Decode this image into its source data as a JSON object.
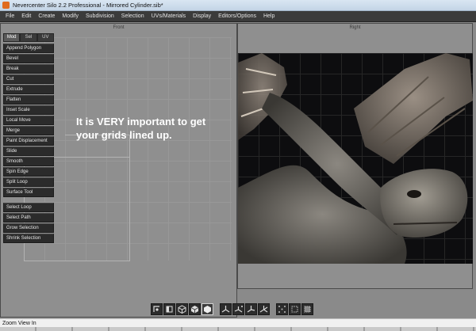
{
  "window": {
    "title": "Nevercenter Silo 2.2 Professional - Mirrored Cylinder.sib*"
  },
  "menubar": {
    "items": [
      "File",
      "Edit",
      "Create",
      "Modify",
      "Subdivision",
      "Selection",
      "UVs/Materials",
      "Display",
      "Editors/Options",
      "Help"
    ]
  },
  "viewports": {
    "left_label": "Front",
    "right_label": "Right"
  },
  "toolpanel": {
    "tabs": [
      "Mod",
      "Sel",
      "UV"
    ],
    "active_tab": "Mod",
    "tools": [
      "Append Polygon",
      "Bevel",
      "Break",
      "Cut",
      "Extrude",
      "Flatten",
      "Inset Scale",
      "Local Move",
      "Merge",
      "Paint Displacement",
      "Slide",
      "Smooth",
      "Spin Edge",
      "Split Loop",
      "Surface Tool"
    ],
    "selection_tools": [
      "Select Loop",
      "Select Path",
      "Grow Selection",
      "Shrink Selection"
    ]
  },
  "overlay": {
    "line1": "It is VERY important to get",
    "line2": "your grids lined up."
  },
  "bottom_toolbar": {
    "icons": [
      "move-tool-icon",
      "face-view-icon",
      "cube-view-icon",
      "cube-shaded-icon",
      "hex-render-icon",
      "axis-x-icon",
      "axis-y-icon",
      "axis-z-icon",
      "axis-all-icon",
      "vertex-select-icon",
      "edge-select-icon",
      "face-select-icon"
    ]
  },
  "statusbar": {
    "text": "Zoom View In"
  }
}
